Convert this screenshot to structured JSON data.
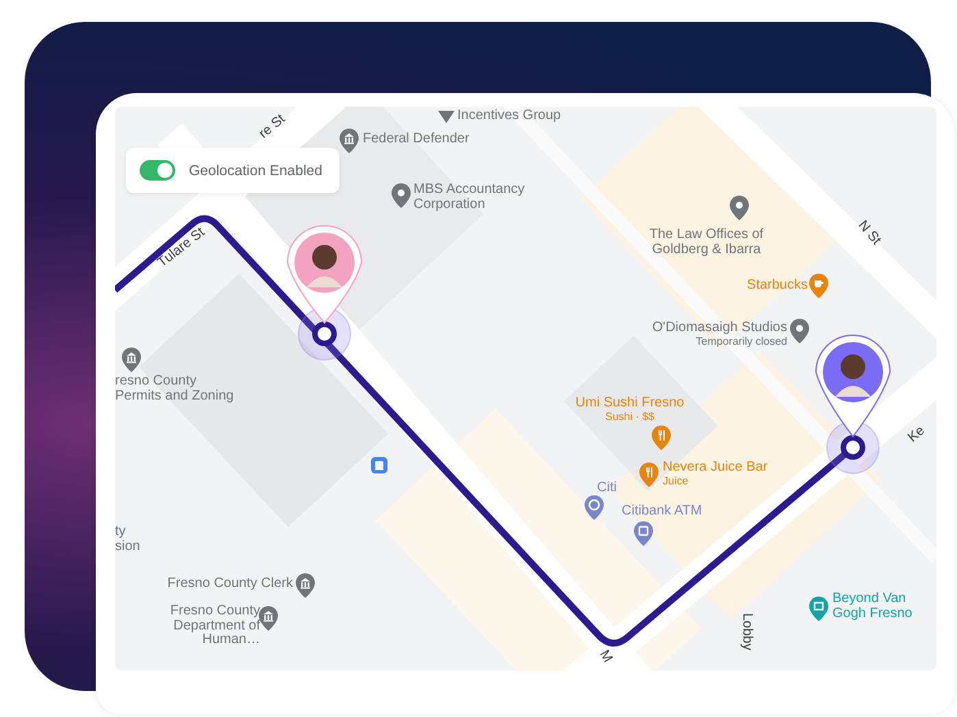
{
  "geolocation_toggle": {
    "label": "Geolocation Enabled",
    "on": true
  },
  "streets": [
    {
      "name": "re St"
    },
    {
      "name": "Tulare St"
    },
    {
      "name": "N St"
    },
    {
      "name": "Ke"
    },
    {
      "name": "M"
    },
    {
      "name": "Lobby"
    }
  ],
  "places": [
    {
      "name": "Incentives Group",
      "kind": "flag",
      "color": "#70757a"
    },
    {
      "name": "Federal Defender",
      "kind": "government",
      "color": "#70757a"
    },
    {
      "name": "MBS Accountancy Corporation",
      "kind": "place",
      "color": "#70757a"
    },
    {
      "name": "The Law Offices of Goldberg & Ibarra",
      "kind": "place",
      "color": "#70757a"
    },
    {
      "name": "Starbucks",
      "kind": "cafe",
      "color": "#e8830c"
    },
    {
      "name": "O'Diomasaigh Studios",
      "subtitle": "Temporarily closed",
      "kind": "place",
      "color": "#70757a"
    },
    {
      "name": "resno County Permits and Zoning",
      "kind": "government",
      "color": "#70757a"
    },
    {
      "name": "Umi Sushi Fresno",
      "subtitle": "Sushi · $$",
      "kind": "restaurant",
      "color": "#e8830c"
    },
    {
      "name": "Citi",
      "kind": "bank",
      "color": "#7986cb"
    },
    {
      "name": "Nevera Juice Bar",
      "subtitle": "Juice",
      "kind": "restaurant",
      "color": "#e8830c"
    },
    {
      "name": "Citibank ATM",
      "kind": "atm",
      "color": "#7986cb"
    },
    {
      "name": "ty sion",
      "kind": "none",
      "color": "#70757a"
    },
    {
      "name": "Fresno County Clerk",
      "kind": "government",
      "color": "#70757a"
    },
    {
      "name": "Fresno County Department of Human…",
      "kind": "government",
      "color": "#70757a"
    },
    {
      "name": "Beyond Van Gogh Fresno",
      "kind": "museum",
      "color": "#12a4a8"
    }
  ],
  "travelers": [
    {
      "color": "#f3a3c0"
    },
    {
      "color": "#7b6cf6"
    }
  ]
}
